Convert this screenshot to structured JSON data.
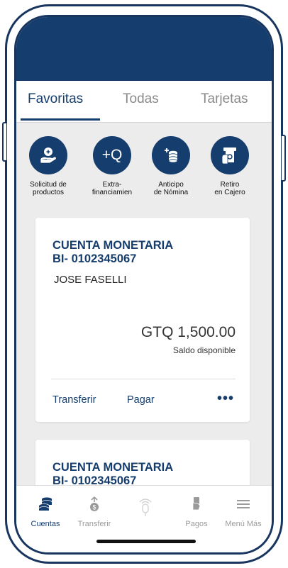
{
  "tabs": [
    {
      "label": "Favoritas",
      "active": true
    },
    {
      "label": "Todas",
      "active": false
    },
    {
      "label": "Tarjetas",
      "active": false
    }
  ],
  "shortcuts": [
    {
      "label": "Solicitud de\nproductos",
      "icon": "hand-add-icon"
    },
    {
      "label": "Extra-\nfinanciamien",
      "icon": "plus-q-icon",
      "icon_text": "+Q"
    },
    {
      "label": "Anticipo\nde Nómina",
      "icon": "coins-plus-icon"
    },
    {
      "label": "Retiro\nen Cajero",
      "icon": "atm-icon"
    }
  ],
  "accounts": [
    {
      "type": "CUENTA MONETARIA",
      "number": "BI- 0102345067",
      "holder": "JOSE FASELLI",
      "balance": "GTQ 1,500.00",
      "balance_label": "Saldo disponible",
      "actions": {
        "transfer": "Transferir",
        "pay": "Pagar",
        "more": "•••"
      }
    },
    {
      "type": "CUENTA MONETARIA",
      "number": "BI- 0102345067"
    }
  ],
  "bottom_nav": [
    {
      "label": "Cuentas",
      "icon": "coins-stack-icon",
      "active": true
    },
    {
      "label": "Transferir",
      "icon": "transfer-money-icon",
      "active": false
    },
    {
      "label": "",
      "icon": "voice-assistant-icon",
      "active": false
    },
    {
      "label": "Pagos",
      "icon": "payment-hand-icon",
      "active": false
    },
    {
      "label": "Menú Más",
      "icon": "menu-icon",
      "active": false
    }
  ],
  "colors": {
    "primary": "#153d6d",
    "background": "#ececec",
    "muted": "#8a8a8a"
  }
}
